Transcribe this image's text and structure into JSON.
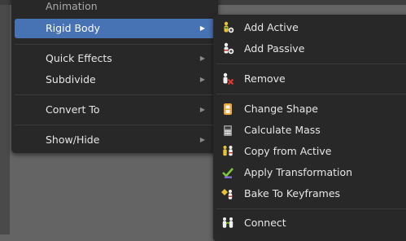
{
  "main_menu": {
    "cut_item": "Animation",
    "items": [
      {
        "label": "Rigid Body",
        "active": true,
        "has_submenu": true
      },
      {
        "label": "Quick Effects",
        "active": false,
        "has_submenu": true
      },
      {
        "label": "Subdivide",
        "active": false,
        "has_submenu": true
      },
      {
        "label": "Convert To",
        "active": false,
        "has_submenu": true
      },
      {
        "label": "Show/Hide",
        "active": false,
        "has_submenu": true
      }
    ],
    "submenu_arrow": "▶"
  },
  "rigid_body_menu": {
    "items": [
      {
        "label": "Add Active",
        "icon": "add-active-icon"
      },
      {
        "label": "Add Passive",
        "icon": "add-passive-icon"
      },
      {
        "label": "Remove",
        "icon": "remove-icon"
      },
      {
        "label": "Change Shape",
        "icon": "change-shape-icon"
      },
      {
        "label": "Calculate Mass",
        "icon": "calculate-mass-icon"
      },
      {
        "label": "Copy from Active",
        "icon": "copy-from-active-icon"
      },
      {
        "label": "Apply Transformation",
        "icon": "apply-transformation-icon"
      },
      {
        "label": "Bake To Keyframes",
        "icon": "bake-keyframes-icon"
      },
      {
        "label": "Connect",
        "icon": "connect-icon"
      }
    ]
  },
  "colors": {
    "menu_bg": "#282828",
    "highlight": "#4772b3",
    "text": "#e6e6e6",
    "separator": "#3b3b3b"
  }
}
